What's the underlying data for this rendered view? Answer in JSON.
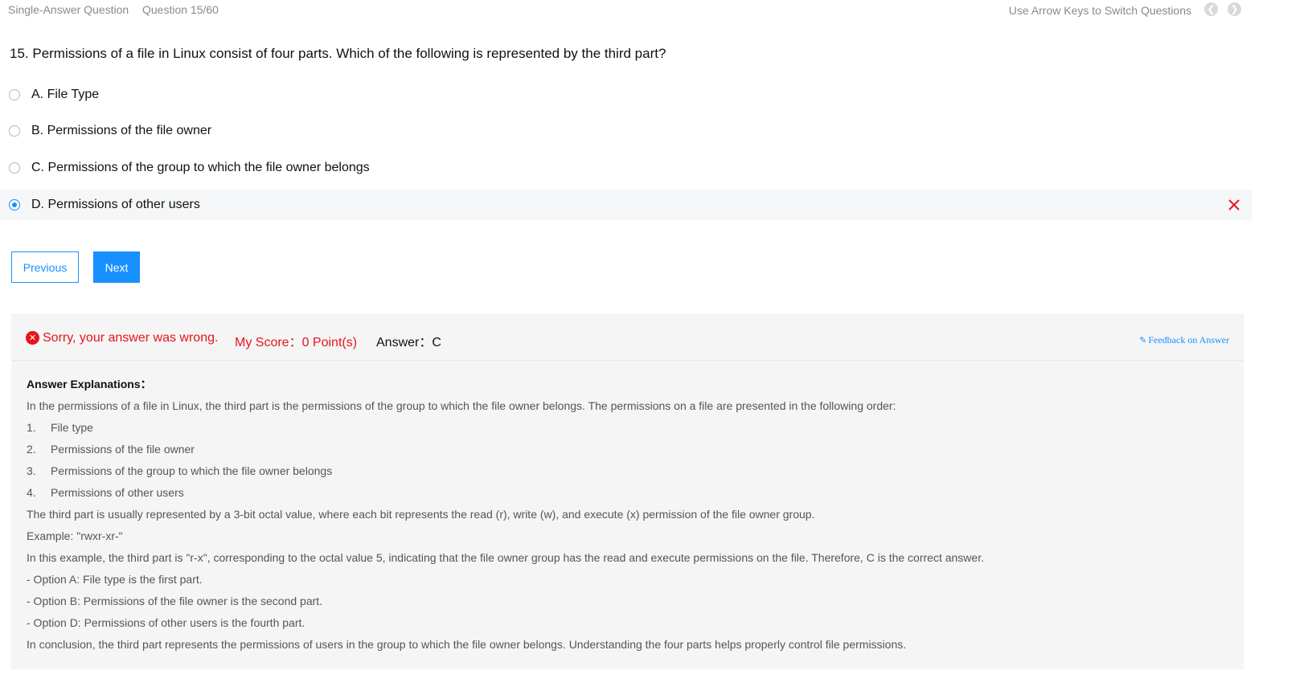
{
  "header": {
    "question_type": "Single-Answer Question",
    "question_counter": "Question 15/60",
    "hint": "Use Arrow Keys to Switch Questions",
    "prev_arrow_icon": "chevron-left-icon",
    "next_arrow_icon": "chevron-right-icon"
  },
  "question": {
    "text": "15. Permissions of a file in Linux consist of four parts. Which of the following is represented by the third part?",
    "options": [
      {
        "label": "A. File Type",
        "selected": false
      },
      {
        "label": "B. Permissions of the file owner",
        "selected": false
      },
      {
        "label": "C. Permissions of the group to which the file owner belongs",
        "selected": false
      },
      {
        "label": "D. Permissions of other users",
        "selected": true,
        "marked_wrong": true
      }
    ]
  },
  "buttons": {
    "previous": "Previous",
    "next": "Next"
  },
  "result": {
    "status": "Sorry, your answer was wrong.",
    "score": "My Score：0 Point(s)",
    "answer": "Answer：C",
    "feedback_link": "Feedback on Answer",
    "error_color": "#e8141b",
    "accent_color": "#1890ff"
  },
  "explanation": {
    "title": "Answer Explanations：",
    "intro": "In the permissions of a file in Linux, the third part is the permissions of the group to which the file owner belongs. The permissions on a file are presented in the following order:",
    "list": [
      {
        "num": "1.",
        "text": "File type"
      },
      {
        "num": "2.",
        "text": "Permissions of the file owner"
      },
      {
        "num": "3.",
        "text": "Permissions of the group to which the file owner belongs"
      },
      {
        "num": "4.",
        "text": "Permissions of other users"
      }
    ],
    "paragraphs": [
      "The third part is usually represented by a 3-bit octal value, where each bit represents the read (r), write (w), and execute (x) permission of the file owner group.",
      "Example: \"rwxr-xr-\"",
      "In this example, the third part is \"r-x\", corresponding to the octal value 5, indicating that the file owner group has the read and execute permissions on the file. Therefore, C is the correct answer.",
      "- Option A: File type is the first part.",
      "- Option B: Permissions of the file owner is the second part.",
      "- Option D: Permissions of other users is the fourth part.",
      "In conclusion, the third part represents the permissions of users in the group to which the file owner belongs. Understanding the four parts helps properly control file permissions."
    ]
  }
}
